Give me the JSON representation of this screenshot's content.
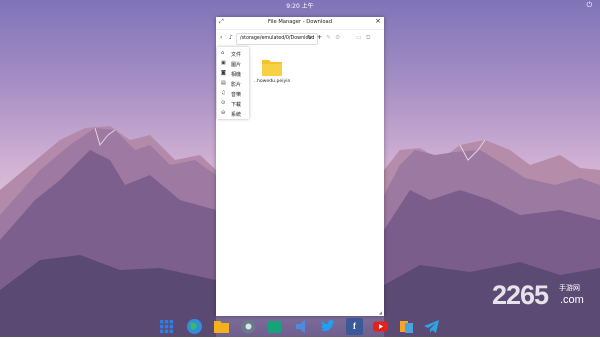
{
  "status_bar": {
    "time": "9:20 上午",
    "power_icon": "power-icon"
  },
  "window": {
    "title": "File Manager - Download",
    "toolbar": {
      "back_icon": "chevron-left-icon",
      "path_prefix_icon": "music-note-icon",
      "path": "/storage/emulated/0/Download",
      "refresh_icon": "refresh-icon",
      "add_icon": "plus-icon"
    },
    "sidebar": {
      "items": [
        {
          "label": "文件",
          "icon": "home-icon"
        },
        {
          "label": "圖片",
          "icon": "image-icon"
        },
        {
          "label": "相機",
          "icon": "camera-icon"
        },
        {
          "label": "影片",
          "icon": "film-icon"
        },
        {
          "label": "音樂",
          "icon": "music-icon"
        },
        {
          "label": "下載",
          "icon": "download-icon"
        },
        {
          "label": "系統",
          "icon": "system-icon"
        }
      ]
    },
    "files": [
      {
        "name": "..howedu.peiyin",
        "type": "folder",
        "color": "#f6c12f"
      }
    ]
  },
  "dock": {
    "apps": [
      {
        "name": "grid-apps-icon",
        "color": "#2f7fe0"
      },
      {
        "name": "globe-icon",
        "color": "#3aa16b"
      },
      {
        "name": "folder-icon",
        "color": "#f3b21d"
      },
      {
        "name": "settings-icon",
        "color": "#6b7a88"
      },
      {
        "name": "store-icon",
        "color": "#15a37a"
      },
      {
        "name": "speaker-icon",
        "color": "#4a8de0"
      },
      {
        "name": "twitter-icon",
        "color": "#1da1f2"
      },
      {
        "name": "facebook-icon",
        "color": "#3b5998"
      },
      {
        "name": "youtube-icon",
        "color": "#e62117"
      },
      {
        "name": "windows-icon",
        "color": "#f4a32b"
      },
      {
        "name": "telegram-icon",
        "color": "#2ca5e0"
      }
    ]
  },
  "watermark": {
    "big": "2265",
    "cn": "手游网",
    "com": ".com"
  }
}
